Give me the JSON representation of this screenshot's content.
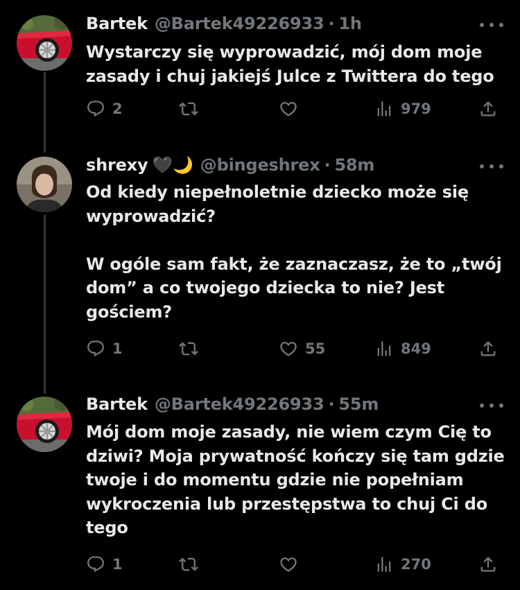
{
  "tweets": [
    {
      "name": "Bartek",
      "emoji": "",
      "handle": "@Bartek49226933",
      "time": "1h",
      "text": "Wystarczy się wyprowadzić, mój dom moje zasady i chuj jakiejś Julce z Twittera do tego",
      "replies": "2",
      "retweets": "",
      "likes": "",
      "views": "979",
      "avatar": "car"
    },
    {
      "name": "shrexy",
      "emoji": "🖤🌙",
      "handle": "@bingeshrex",
      "time": "58m",
      "text": "Od kiedy niepełnoletnie dziecko może się wyprowadzić?\n\nW ogóle sam fakt, że zaznaczasz, że to „twój dom” a co twojego dziecka to nie? Jest gościem?",
      "replies": "1",
      "retweets": "",
      "likes": "55",
      "views": "849",
      "avatar": "person"
    },
    {
      "name": "Bartek",
      "emoji": "",
      "handle": "@Bartek49226933",
      "time": "55m",
      "text": "Mój dom moje zasady, nie wiem czym Cię to dziwi? Moja prywatność kończy się tam gdzie twoje i do momentu gdzie nie popełniam wykroczenia lub przestępstwa to chuj Ci do tego",
      "replies": "1",
      "retweets": "",
      "likes": "",
      "views": "270",
      "avatar": "car"
    }
  ],
  "separator": "·",
  "colors": {
    "background": "#000000",
    "text": "#e7e9ea",
    "muted": "#71767b",
    "thread_line": "#333639"
  },
  "icons": {
    "reply": "reply-icon",
    "retweet": "retweet-icon",
    "like": "heart-icon",
    "views": "views-icon",
    "share": "share-icon",
    "more": "more-icon"
  }
}
